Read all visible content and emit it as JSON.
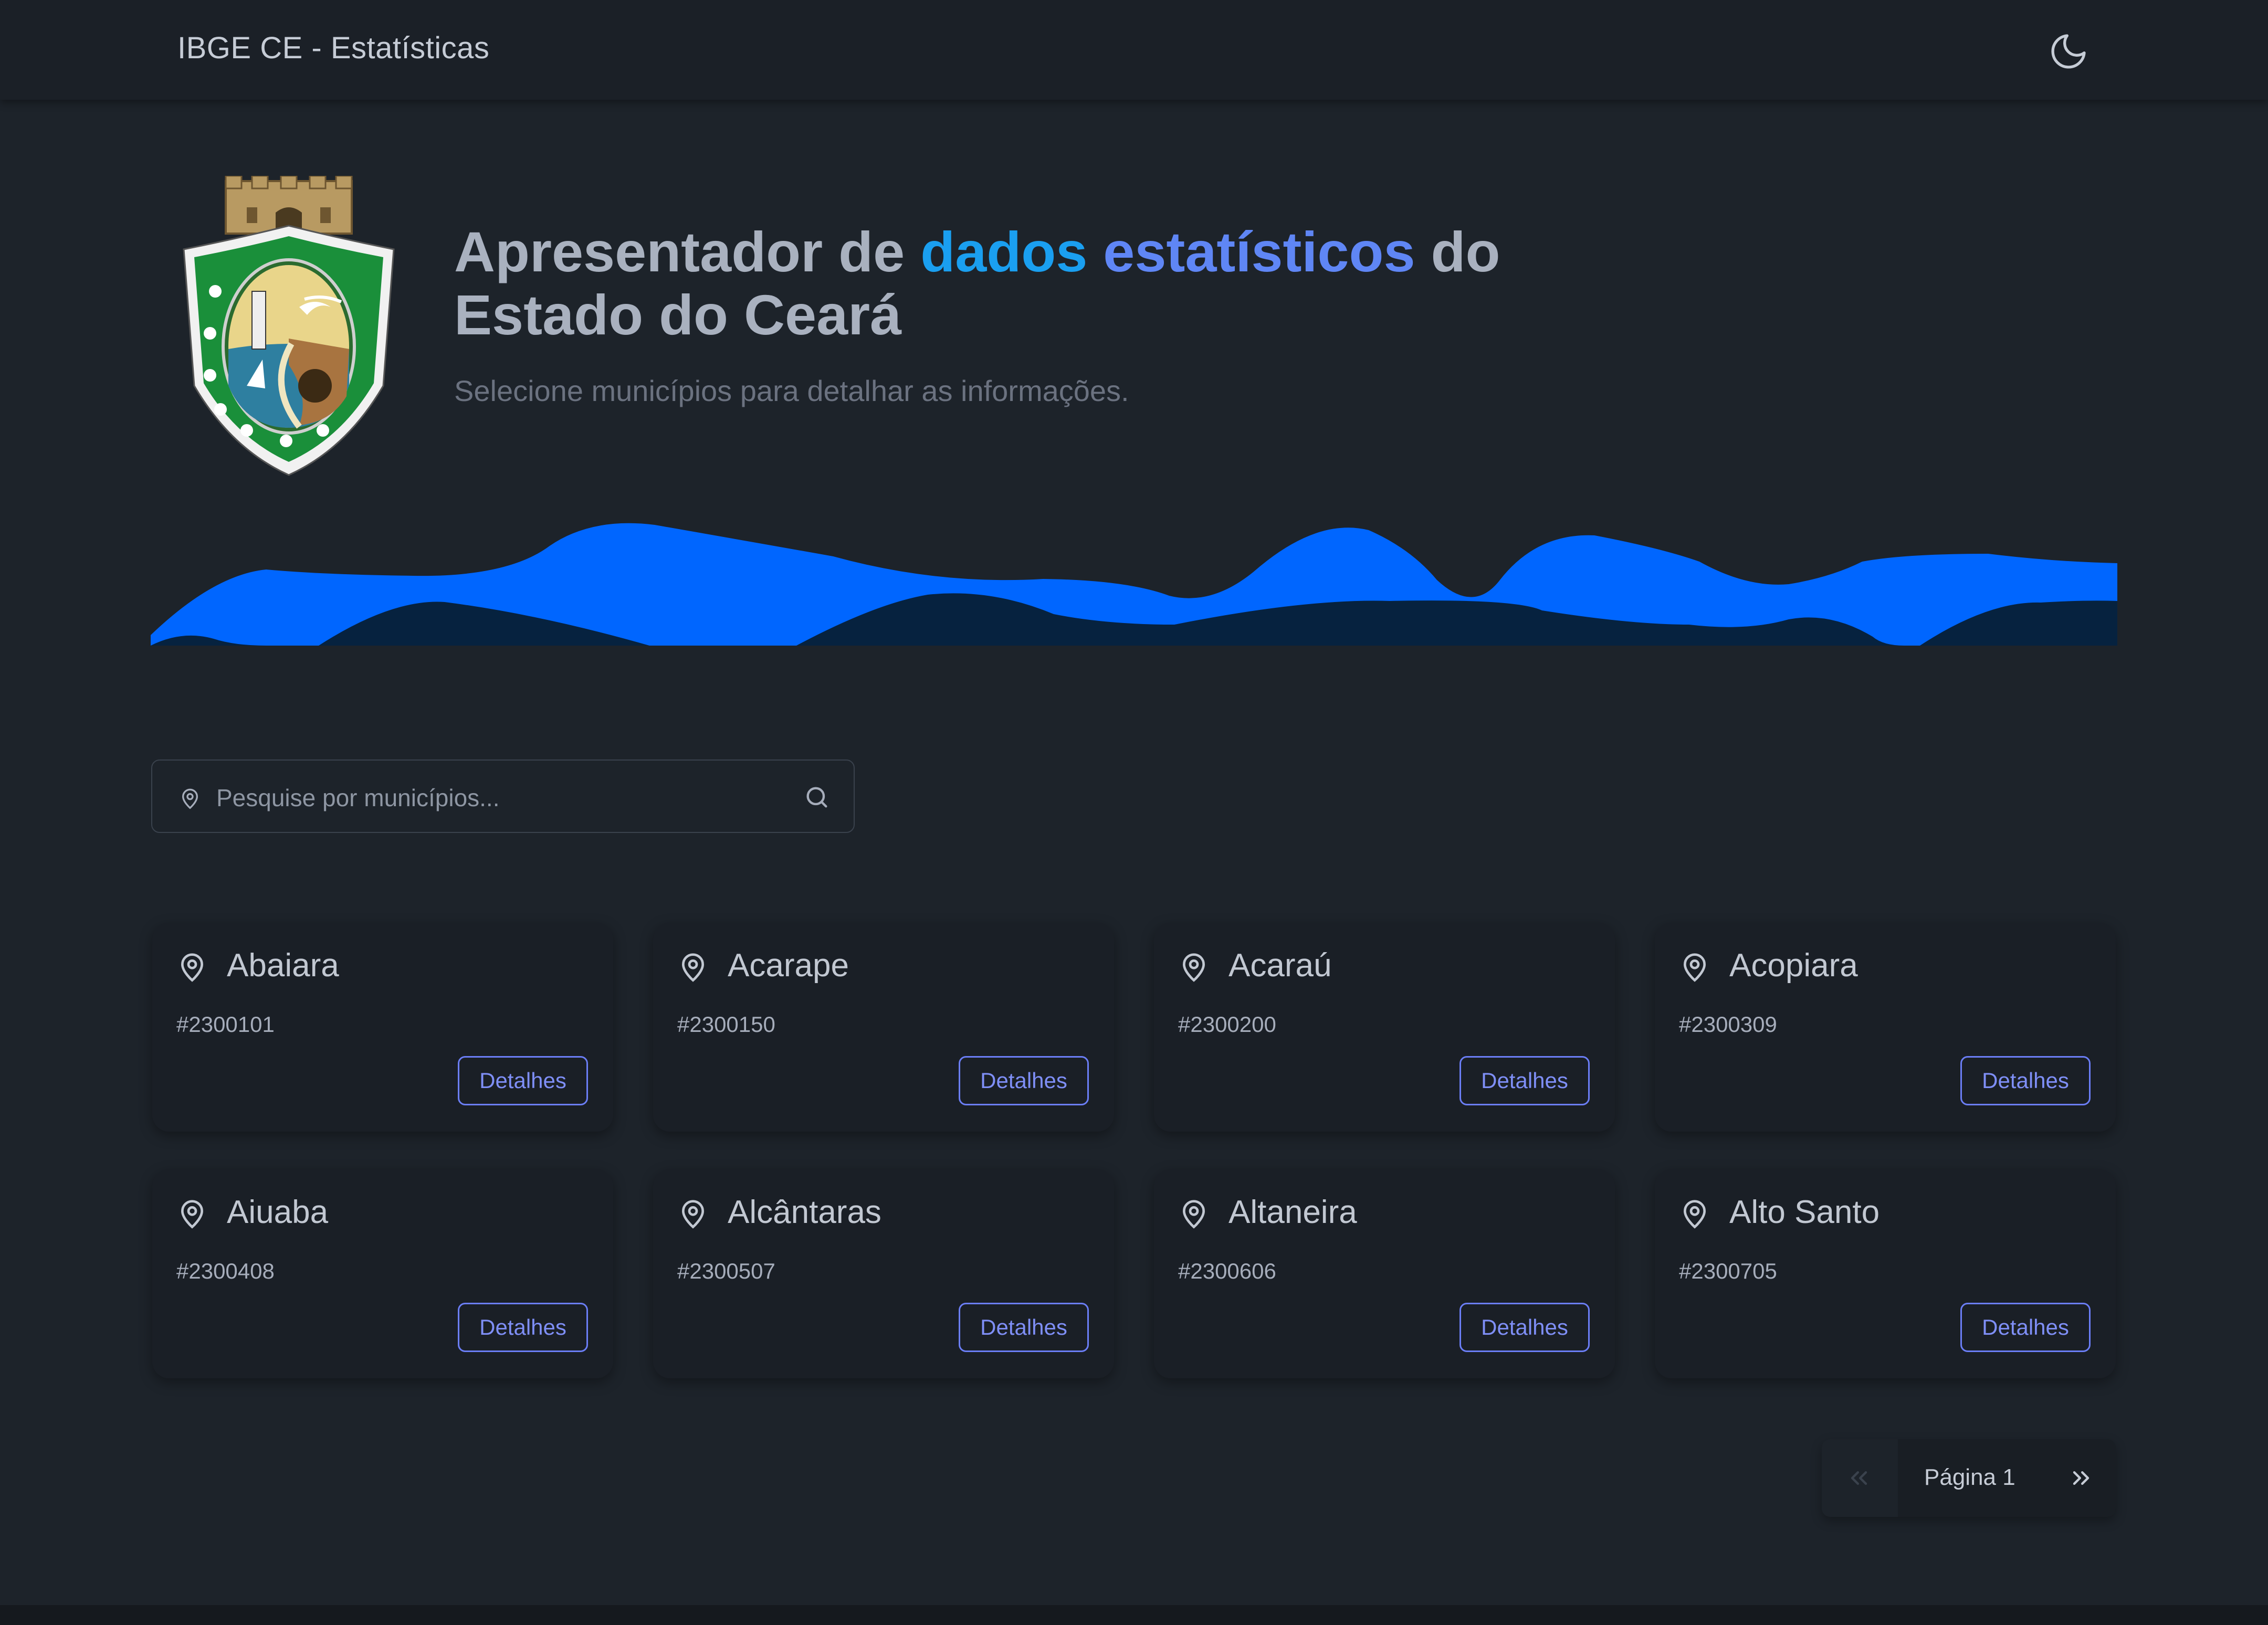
{
  "header": {
    "title": "IBGE CE - Estatísticas",
    "theme_icon": "moon-icon"
  },
  "hero": {
    "logo": "ceara-coat-of-arms",
    "title_part1": "Apresentador de ",
    "title_highlight_a": "dados ",
    "title_highlight_b": "estatísticos",
    "title_part2": " do",
    "title_line2": "Estado do Ceará",
    "subtitle": "Selecione municípios para detalhar as informações."
  },
  "search": {
    "placeholder": "Pesquise por municípios...",
    "value": ""
  },
  "municipios": [
    {
      "name": "Abaiara",
      "code": "#2300101",
      "action": "Detalhes"
    },
    {
      "name": "Acarape",
      "code": "#2300150",
      "action": "Detalhes"
    },
    {
      "name": "Acaraú",
      "code": "#2300200",
      "action": "Detalhes"
    },
    {
      "name": "Acopiara",
      "code": "#2300309",
      "action": "Detalhes"
    },
    {
      "name": "Aiuaba",
      "code": "#2300408",
      "action": "Detalhes"
    },
    {
      "name": "Alcântaras",
      "code": "#2300507",
      "action": "Detalhes"
    },
    {
      "name": "Altaneira",
      "code": "#2300606",
      "action": "Detalhes"
    },
    {
      "name": "Alto Santo",
      "code": "#2300705",
      "action": "Detalhes"
    }
  ],
  "pagination": {
    "label": "Página 1"
  },
  "colors": {
    "background": "#1d232a",
    "accent": "#0066ff",
    "primary": "#6b7ef6",
    "highlight": "#1a9ff0"
  }
}
